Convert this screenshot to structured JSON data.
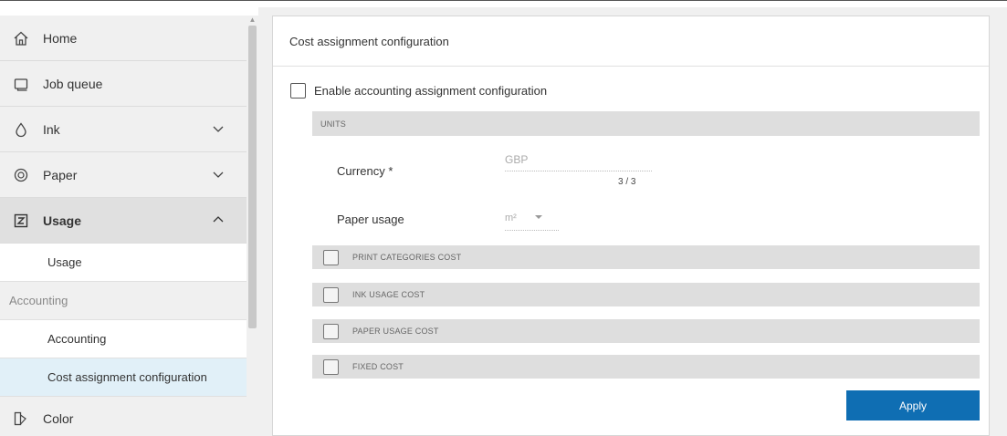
{
  "sidebar": {
    "nav": {
      "home": "Home",
      "job_queue": "Job queue",
      "ink": "Ink",
      "paper": "Paper",
      "usage": "Usage",
      "color": "Color"
    },
    "sub": {
      "usage": "Usage",
      "accounting_group": "Accounting",
      "accounting": "Accounting",
      "cost_assignment": "Cost assignment configuration"
    },
    "icons": {
      "home": "home-icon",
      "job_queue": "job-queue-icon",
      "ink": "ink-drop-icon",
      "paper": "paper-roll-icon",
      "usage": "usage-icon",
      "color": "color-icon"
    }
  },
  "main": {
    "title": "Cost assignment configuration",
    "enable_label": "Enable accounting assignment configuration",
    "enable_checked": false,
    "units_header": "UNITS",
    "currency_label": "Currency *",
    "currency_value": "GBP",
    "currency_count": "3 / 3",
    "paper_usage_label": "Paper usage",
    "paper_usage_value": "m²",
    "sections": {
      "print_categories": "PRINT CATEGORIES COST",
      "ink_usage": "INK USAGE COST",
      "paper_usage": "PAPER USAGE COST",
      "fixed": "FIXED COST"
    },
    "apply_label": "Apply"
  },
  "colors": {
    "accent": "#0f6eb3",
    "selected_bg": "#e1f0f8",
    "sidebar_bg": "#f0f0f0",
    "section_bg": "#dedede"
  }
}
